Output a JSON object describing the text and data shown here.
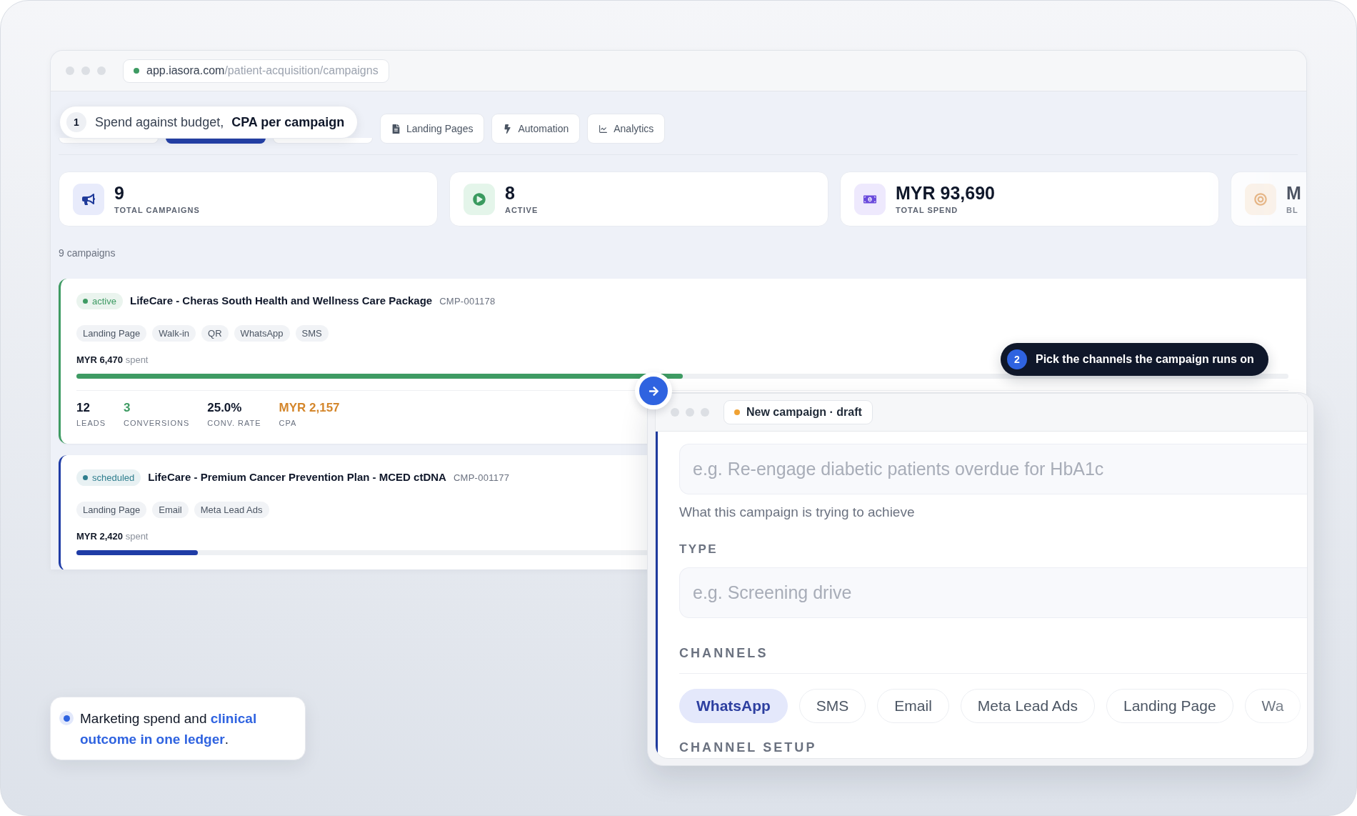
{
  "browser": {
    "url_host": "app.iasora.com",
    "url_path": "/patient-acquisition/campaigns"
  },
  "spend_callout": {
    "number": "1",
    "text": "Spend against budget, **CPA per campaign**"
  },
  "tabs": [
    {
      "selected": false
    },
    {
      "selected": true
    },
    {
      "selected": false
    },
    {
      "label": "Landing Pages",
      "kind": "pages",
      "selected": false
    },
    {
      "label": "Automation",
      "kind": "automation",
      "selected": false
    },
    {
      "label": "Analytics",
      "kind": "analytics",
      "selected": false
    }
  ],
  "stats": [
    {
      "kind": "megaphone",
      "value": "9",
      "label": "TOTAL CAMPAIGNS"
    },
    {
      "kind": "play",
      "value": "8",
      "label": "ACTIVE"
    },
    {
      "kind": "money",
      "value": "MYR 93,690",
      "label": "TOTAL SPEND"
    },
    {
      "kind": "target",
      "value": "M",
      "label": "BL"
    }
  ],
  "campaign_count": "9 campaigns",
  "campaigns": [
    {
      "status": {
        "label": "active",
        "color": "#3e9b63"
      },
      "title": "LifeCare - Cheras South Health and Wellness Care Package",
      "code": "CMP-001178",
      "tags": [
        "Landing Page",
        "Walk-in",
        "QR",
        "WhatsApp",
        "SMS"
      ],
      "spent": "MYR 6,470",
      "spent_label": "spent",
      "level": 0.5,
      "color": "#3e9b63",
      "metrics": [
        {
          "value": "12",
          "label": "LEADS",
          "color": "#0f172a"
        },
        {
          "value": "3",
          "label": "CONVERSIONS",
          "color": "#3e9b63"
        },
        {
          "value": "25.0%",
          "label": "CONV. RATE",
          "color": "#0f172a"
        },
        {
          "value": "MYR 2,157",
          "label": "CPA",
          "color": "#d4862b"
        }
      ]
    },
    {
      "status": {
        "label": "scheduled",
        "color": "#2f7e8e"
      },
      "title": "LifeCare - Premium Cancer Prevention Plan - MCED ctDNA",
      "code": "CMP-001177",
      "tags": [
        "Landing Page",
        "Email",
        "Meta Lead Ads"
      ],
      "spent": "MYR 2,420",
      "spent_label": "spent",
      "level": 0.1,
      "color": "#1f3ca6"
    }
  ],
  "channels_callout": {
    "number": "2",
    "text": "Pick the channels the campaign runs on"
  },
  "draft": {
    "title": "New campaign · draft",
    "goal_field": {
      "placeholder": "e.g. Re-engage diabetic patients overdue for HbA1c"
    },
    "goal_hint": "What this campaign is trying to achieve",
    "type_label": "TYPE",
    "type_field": {
      "placeholder": "e.g. Screening drive"
    },
    "channels_label": "CHANNELS",
    "channels": [
      {
        "label": "WhatsApp",
        "selected": true
      },
      {
        "label": "SMS",
        "selected": false
      },
      {
        "label": "Email",
        "selected": false
      },
      {
        "label": "Meta Lead Ads",
        "selected": false
      },
      {
        "label": "Landing Page",
        "selected": false
      },
      {
        "label": "Wa",
        "selected": false
      }
    ],
    "next_section_label": "CHANNEL SETUP"
  },
  "note": {
    "text": "Marketing spend and **clinical outcome in one ledger**."
  }
}
